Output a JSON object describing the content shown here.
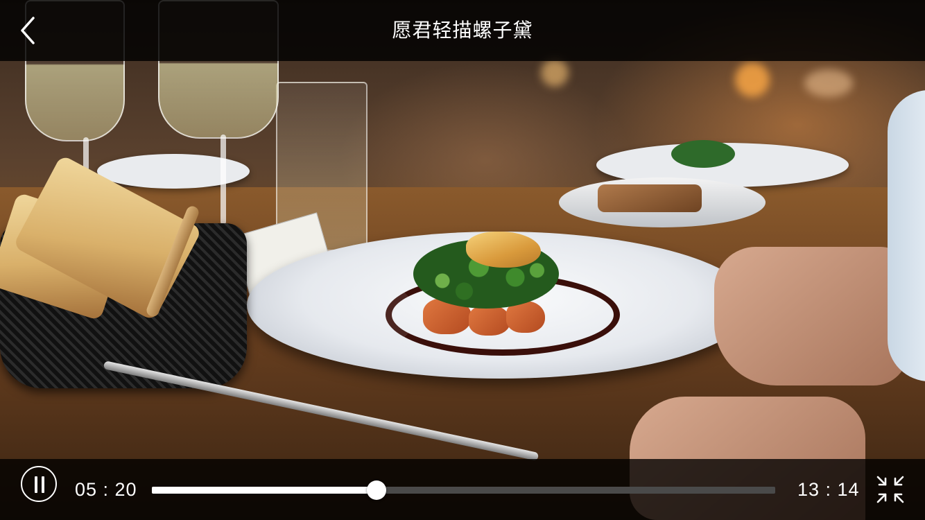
{
  "player": {
    "title": "愿君轻描螺子黛",
    "current_time": "05 : 20",
    "total_time": "13 : 14",
    "progress_fraction": 0.36,
    "state": "playing"
  },
  "icons": {
    "back": "back-arrow-icon",
    "pause": "pause-icon",
    "exit_fullscreen": "exit-fullscreen-icon"
  },
  "colors": {
    "overlay_bar": "#000000",
    "text": "#ffffff",
    "progress_played": "#ffffff",
    "progress_remaining": "#4a4a4a"
  }
}
